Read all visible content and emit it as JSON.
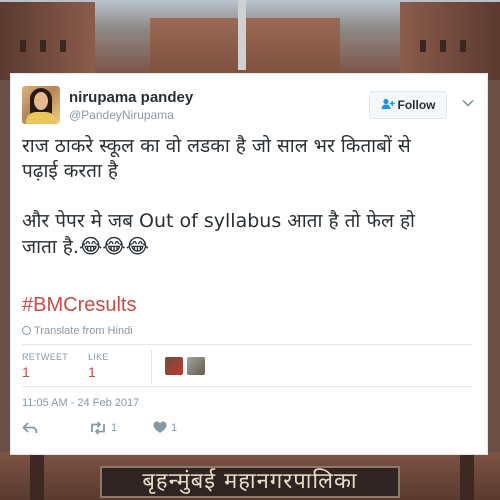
{
  "background": {
    "signboard_text": "बृहन्मुंबई महानगरपालिका"
  },
  "tweet": {
    "author_name": "nirupama pandey",
    "author_handle": "@PandeyNirupama",
    "follow_label": "Follow",
    "text_lines": [
      "राज ठाकरे स्कूल का वो लडका है जो साल भर किताबों से",
      "पढ़ाई करता है",
      "और पेपर मे जब Out of syllabus आता है तो फेल हो",
      "जाता है."
    ],
    "emojis": "😂😂😂",
    "hashtag": "#BMCresults",
    "translate_label": "Translate from Hindi",
    "retweet_label": "RETWEET",
    "retweet_count": "1",
    "like_label": "LIKE",
    "like_count": "1",
    "timestamp": "11:05 AM - 24 Feb 2017",
    "action_retweet_count": "1",
    "action_like_count": "1"
  },
  "colors": {
    "accent": "#c94b45",
    "text": "#292f33",
    "muted": "#8899a6",
    "border": "#e1e8ed"
  },
  "icons": [
    "follow-user-icon",
    "chevron-down-icon",
    "globe-icon",
    "reply-icon",
    "retweet-icon",
    "heart-icon"
  ]
}
